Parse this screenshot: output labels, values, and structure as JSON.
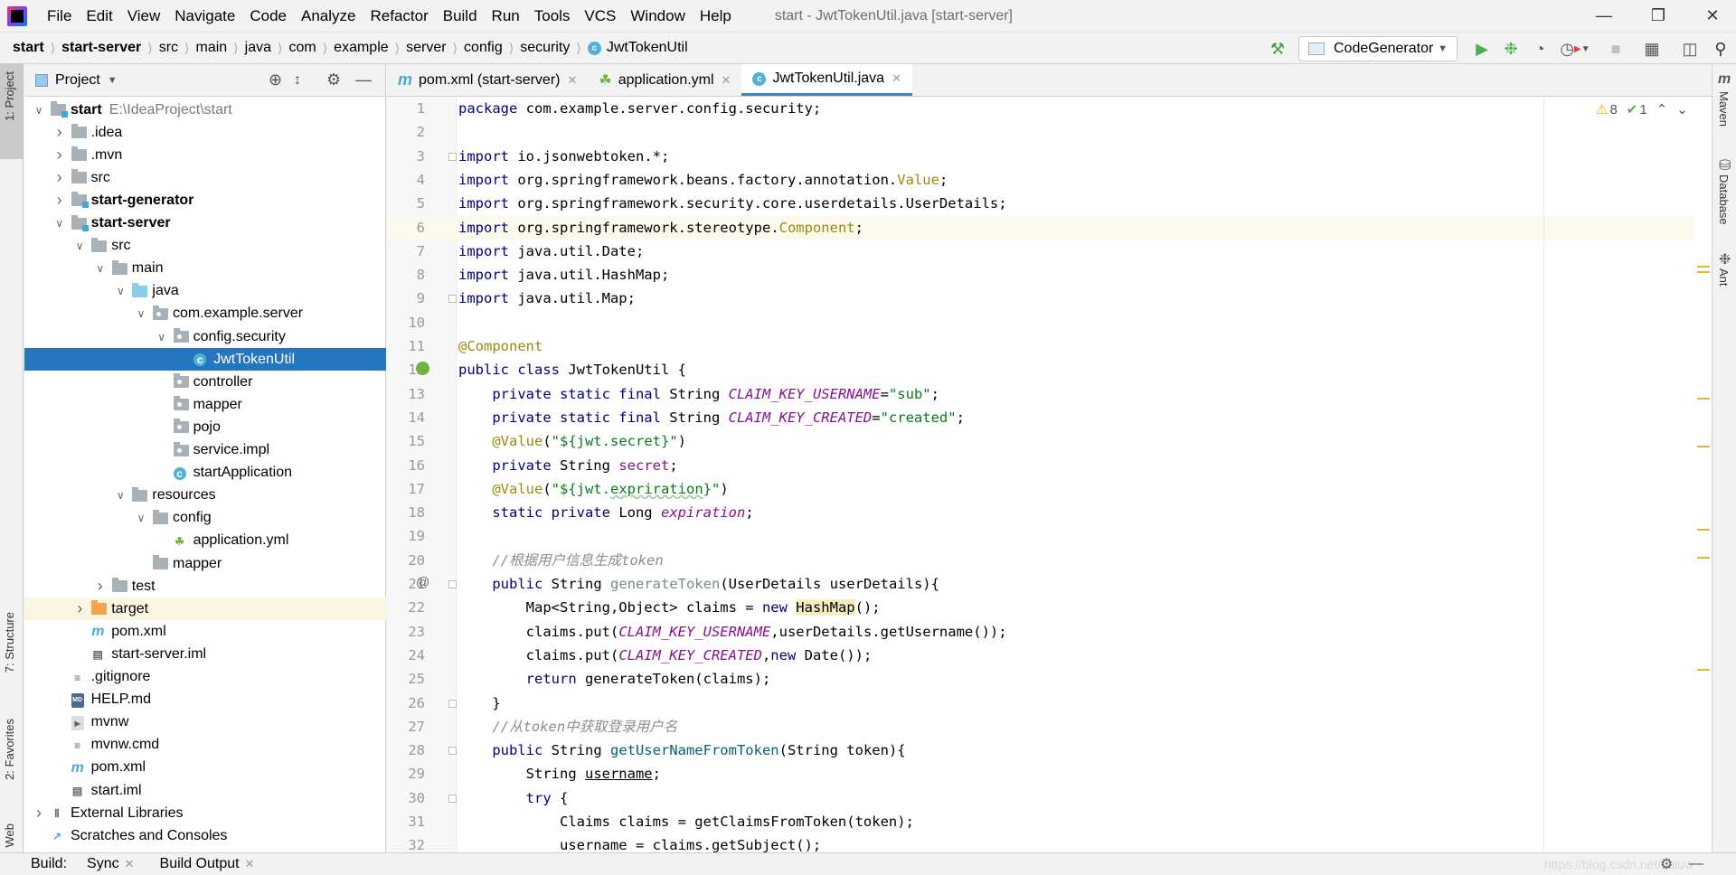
{
  "menu": {
    "items": [
      "File",
      "Edit",
      "View",
      "Navigate",
      "Code",
      "Analyze",
      "Refactor",
      "Build",
      "Run",
      "Tools",
      "VCS",
      "Window",
      "Help"
    ],
    "window_title": "start - JwtTokenUtil.java [start-server]"
  },
  "breadcrumb": [
    "start",
    "start-server",
    "src",
    "main",
    "java",
    "com",
    "example",
    "server",
    "config",
    "security",
    "JwtTokenUtil"
  ],
  "toolbar": {
    "run_config": "CodeGenerator"
  },
  "left_stripe": {
    "project": "1: Project",
    "structure": "7: Structure",
    "favorites": "2: Favorites",
    "web": "Web"
  },
  "right_stripe": [
    "Maven",
    "Database",
    "Ant"
  ],
  "project": {
    "title": "Project",
    "tree": [
      {
        "level": 0,
        "label": "start",
        "hint": "E:\\IdeaProject\\start",
        "arrow": "open",
        "icon": "module",
        "bold": true
      },
      {
        "level": 1,
        "label": ".idea",
        "arrow": "closed",
        "icon": "folder"
      },
      {
        "level": 1,
        "label": ".mvn",
        "arrow": "closed",
        "icon": "folder"
      },
      {
        "level": 1,
        "label": "src",
        "arrow": "closed",
        "icon": "folder"
      },
      {
        "level": 1,
        "label": "start-generator",
        "arrow": "closed",
        "icon": "module",
        "bold": true
      },
      {
        "level": 1,
        "label": "start-server",
        "arrow": "open",
        "icon": "module",
        "bold": true
      },
      {
        "level": 2,
        "label": "src",
        "arrow": "open",
        "icon": "folder"
      },
      {
        "level": 3,
        "label": "main",
        "arrow": "open",
        "icon": "folder"
      },
      {
        "level": 4,
        "label": "java",
        "arrow": "open",
        "icon": "source-folder"
      },
      {
        "level": 5,
        "label": "com.example.server",
        "arrow": "open",
        "icon": "package"
      },
      {
        "level": 6,
        "label": "config.security",
        "arrow": "open",
        "icon": "package"
      },
      {
        "level": 7,
        "label": "JwtTokenUtil",
        "icon": "class",
        "selected": true
      },
      {
        "level": 6,
        "label": "controller",
        "icon": "package"
      },
      {
        "level": 6,
        "label": "mapper",
        "icon": "package"
      },
      {
        "level": 6,
        "label": "pojo",
        "icon": "package"
      },
      {
        "level": 6,
        "label": "service.impl",
        "icon": "package"
      },
      {
        "level": 6,
        "label": "startApplication",
        "icon": "spring-class"
      },
      {
        "level": 4,
        "label": "resources",
        "arrow": "open",
        "icon": "folder"
      },
      {
        "level": 5,
        "label": "config",
        "arrow": "open",
        "icon": "folder"
      },
      {
        "level": 6,
        "label": "application.yml",
        "icon": "yml"
      },
      {
        "level": 5,
        "label": "mapper",
        "icon": "folder"
      },
      {
        "level": 3,
        "label": "test",
        "arrow": "closed",
        "icon": "folder"
      },
      {
        "level": 2,
        "label": "target",
        "arrow": "closed",
        "icon": "excluded-folder",
        "excluded": true
      },
      {
        "level": 2,
        "label": "pom.xml",
        "icon": "maven"
      },
      {
        "level": 2,
        "label": "start-server.iml",
        "icon": "iml"
      },
      {
        "level": 1,
        "label": ".gitignore",
        "icon": "text"
      },
      {
        "level": 1,
        "label": "HELP.md",
        "icon": "markdown"
      },
      {
        "level": 1,
        "label": "mvnw",
        "icon": "script"
      },
      {
        "level": 1,
        "label": "mvnw.cmd",
        "icon": "text"
      },
      {
        "level": 1,
        "label": "pom.xml",
        "icon": "maven"
      },
      {
        "level": 1,
        "label": "start.iml",
        "icon": "iml"
      },
      {
        "level": 0,
        "label": "External Libraries",
        "arrow": "closed",
        "icon": "libraries"
      },
      {
        "level": 0,
        "label": "Scratches and Consoles",
        "icon": "scratches"
      }
    ]
  },
  "tabs": [
    {
      "label": "pom.xml (start-server)",
      "icon": "maven"
    },
    {
      "label": "application.yml",
      "icon": "yml"
    },
    {
      "label": "JwtTokenUtil.java",
      "icon": "class",
      "active": true
    }
  ],
  "inspections": {
    "warnings": "8",
    "typos": "1"
  },
  "editor": {
    "caret_line": 6,
    "lines": [
      [
        [
          "kw",
          "package "
        ],
        [
          "",
          "com.example.server.config.security;"
        ]
      ],
      [],
      [
        [
          "kw",
          "import "
        ],
        [
          "",
          "io.jsonwebtoken.*;"
        ]
      ],
      [
        [
          "kw",
          "import "
        ],
        [
          "",
          "org.springframework.beans.factory.annotation."
        ],
        [
          "ann",
          "Value"
        ],
        [
          "",
          ";"
        ]
      ],
      [
        [
          "kw",
          "import "
        ],
        [
          "",
          "org.springframework.security.core.userdetails.UserDetails;"
        ]
      ],
      [
        [
          "kw",
          "import "
        ],
        [
          "",
          "org.springframework.stereotype."
        ],
        [
          "ann",
          "Component"
        ],
        [
          "",
          ";"
        ]
      ],
      [
        [
          "kw",
          "import "
        ],
        [
          "",
          "java.util.Date;"
        ]
      ],
      [
        [
          "kw",
          "import "
        ],
        [
          "",
          "java.util.HashMap;"
        ]
      ],
      [
        [
          "kw",
          "import "
        ],
        [
          "",
          "java.util.Map;"
        ]
      ],
      [],
      [
        [
          "ann",
          "@Component"
        ]
      ],
      [
        [
          "kw",
          "public class "
        ],
        [
          "",
          "JwtTokenUtil {"
        ]
      ],
      [
        [
          "",
          "    "
        ],
        [
          "kw",
          "private static final "
        ],
        [
          "",
          "String "
        ],
        [
          "fld",
          "CLAIM_KEY_USERNAME"
        ],
        [
          "",
          "="
        ],
        [
          "str",
          "\"sub\""
        ],
        [
          "",
          ";"
        ]
      ],
      [
        [
          "",
          "    "
        ],
        [
          "kw",
          "private static final "
        ],
        [
          "",
          "String "
        ],
        [
          "fld",
          "CLAIM_KEY_CREATED"
        ],
        [
          "",
          "="
        ],
        [
          "str",
          "\"created\""
        ],
        [
          "",
          ";"
        ]
      ],
      [
        [
          "",
          "    "
        ],
        [
          "ann",
          "@Value"
        ],
        [
          "",
          "("
        ],
        [
          "str",
          "\"${jwt.secret}\""
        ],
        [
          "",
          ")"
        ]
      ],
      [
        [
          "",
          "    "
        ],
        [
          "kw",
          "private "
        ],
        [
          "",
          "String "
        ],
        [
          "ifld",
          "secret"
        ],
        [
          "",
          ";"
        ]
      ],
      [
        [
          "",
          "    "
        ],
        [
          "ann",
          "@Value"
        ],
        [
          "",
          "("
        ],
        [
          "str",
          "\"${jwt."
        ],
        [
          "str wavy",
          "expriration"
        ],
        [
          "str",
          "}\""
        ],
        [
          "",
          ")"
        ]
      ],
      [
        [
          "",
          "    "
        ],
        [
          "kw",
          "static private "
        ],
        [
          "",
          "Long "
        ],
        [
          "fld",
          "expiration"
        ],
        [
          "",
          ";"
        ]
      ],
      [],
      [
        [
          "",
          "    "
        ],
        [
          "cmt",
          "//根据用户信息生成token"
        ]
      ],
      [
        [
          "",
          "    "
        ],
        [
          "kw",
          "public "
        ],
        [
          "",
          "String "
        ],
        [
          "mthu",
          "generateToken"
        ],
        [
          "",
          "(UserDetails userDetails){"
        ]
      ],
      [
        [
          "",
          "        Map<String,Object> claims = "
        ],
        [
          "kw",
          "new "
        ],
        [
          "hl",
          "HashMap"
        ],
        [
          "",
          "();"
        ]
      ],
      [
        [
          "",
          "        claims.put("
        ],
        [
          "fld",
          "CLAIM_KEY_USERNAME"
        ],
        [
          "",
          ",userDetails.getUsername());"
        ]
      ],
      [
        [
          "",
          "        claims.put("
        ],
        [
          "fld",
          "CLAIM_KEY_CREATED"
        ],
        [
          "",
          ","
        ],
        [
          "kw",
          "new "
        ],
        [
          "",
          "Date());"
        ]
      ],
      [
        [
          "",
          "        "
        ],
        [
          "kw",
          "return "
        ],
        [
          "",
          "generateToken(claims);"
        ]
      ],
      [
        [
          "",
          "    }"
        ]
      ],
      [
        [
          "",
          "    "
        ],
        [
          "cmt",
          "//从token中获取登录用户名"
        ]
      ],
      [
        [
          "",
          "    "
        ],
        [
          "kw",
          "public "
        ],
        [
          "",
          "String "
        ],
        [
          "mth",
          "getUserNameFromToken"
        ],
        [
          "",
          "(String token){"
        ]
      ],
      [
        [
          "",
          "        String "
        ],
        [
          "ul",
          "username"
        ],
        [
          "",
          ";"
        ]
      ],
      [
        [
          "",
          "        "
        ],
        [
          "kw",
          "try "
        ],
        [
          "",
          "{"
        ]
      ],
      [
        [
          "",
          "            Claims claims = getClaimsFromToken(token);"
        ]
      ],
      [
        [
          "",
          "            username = claims.getSubject();"
        ]
      ]
    ]
  },
  "status": {
    "build": "Build:",
    "sync": "Sync",
    "build_output": "Build Output",
    "watermark": "https://blog.csdn.net/tailuw"
  }
}
